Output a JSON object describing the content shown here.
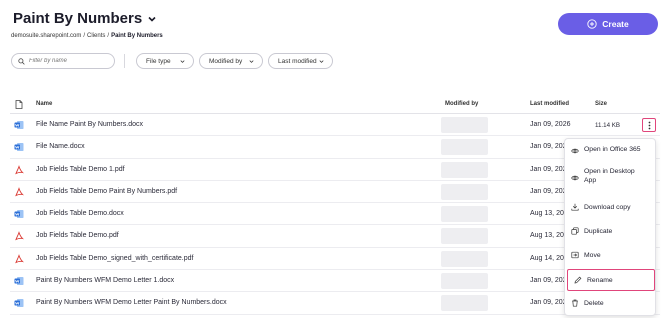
{
  "header": {
    "title": "Paint By Numbers",
    "create_label": "Create"
  },
  "breadcrumb": {
    "site": "demosuite.sharepoint.com",
    "clients": "Clients",
    "current": "Paint By Numbers",
    "separator": "/"
  },
  "filters": {
    "search_placeholder": "Filter by name",
    "file_type": "File type",
    "modified_by": "Modified by",
    "last_modified": "Last modified"
  },
  "table": {
    "headers": {
      "name": "Name",
      "modified_by": "Modified by",
      "last_modified": "Last modified",
      "size": "Size"
    },
    "rows": [
      {
        "icon": "word-doc-icon",
        "name": "File Name Paint By Numbers.docx",
        "date": "Jan 09, 2026",
        "size": "11.14 KB"
      },
      {
        "icon": "word-doc-icon",
        "name": "File Name.docx",
        "date": "Jan 09, 2026",
        "size": ""
      },
      {
        "icon": "pdf-icon",
        "name": "Job Fields Table Demo 1.pdf",
        "date": "Jan 09, 2026",
        "size": ""
      },
      {
        "icon": "pdf-icon",
        "name": "Job Fields Table Demo Paint By Numbers.pdf",
        "date": "Jan 09, 2026",
        "size": ""
      },
      {
        "icon": "word-doc-icon",
        "name": "Job Fields Table Demo.docx",
        "date": "Aug 13, 2025",
        "size": ""
      },
      {
        "icon": "pdf-icon",
        "name": "Job Fields Table Demo.pdf",
        "date": "Aug 13, 2025",
        "size": ""
      },
      {
        "icon": "pdf-icon",
        "name": "Job Fields Table Demo_signed_with_certificate.pdf",
        "date": "Aug 14, 2025",
        "size": ""
      },
      {
        "icon": "word-doc-icon",
        "name": "Paint By Numbers WFM Demo Letter 1.docx",
        "date": "Jan 09, 2026",
        "size": ""
      },
      {
        "icon": "word-doc-icon",
        "name": "Paint By Numbers WFM Demo Letter Paint By Numbers.docx",
        "date": "Jan 09, 2026",
        "size": ""
      }
    ]
  },
  "context_menu": {
    "items": [
      {
        "label": "Open in Office 365",
        "icon": "eye-icon"
      },
      {
        "label": "Open in Desktop App",
        "icon": "eye-icon"
      },
      {
        "label": "Download copy",
        "icon": "download-icon"
      },
      {
        "label": "Duplicate",
        "icon": "duplicate-icon"
      },
      {
        "label": "Move",
        "icon": "move-icon"
      },
      {
        "label": "Rename",
        "icon": "pencil-icon",
        "highlighted": true
      },
      {
        "label": "Delete",
        "icon": "trash-icon"
      }
    ]
  },
  "colors": {
    "accent": "#6a5ee6",
    "highlight": "#e0457b",
    "word_blue": "#2b6fd8",
    "pdf_red": "#d9362f"
  }
}
